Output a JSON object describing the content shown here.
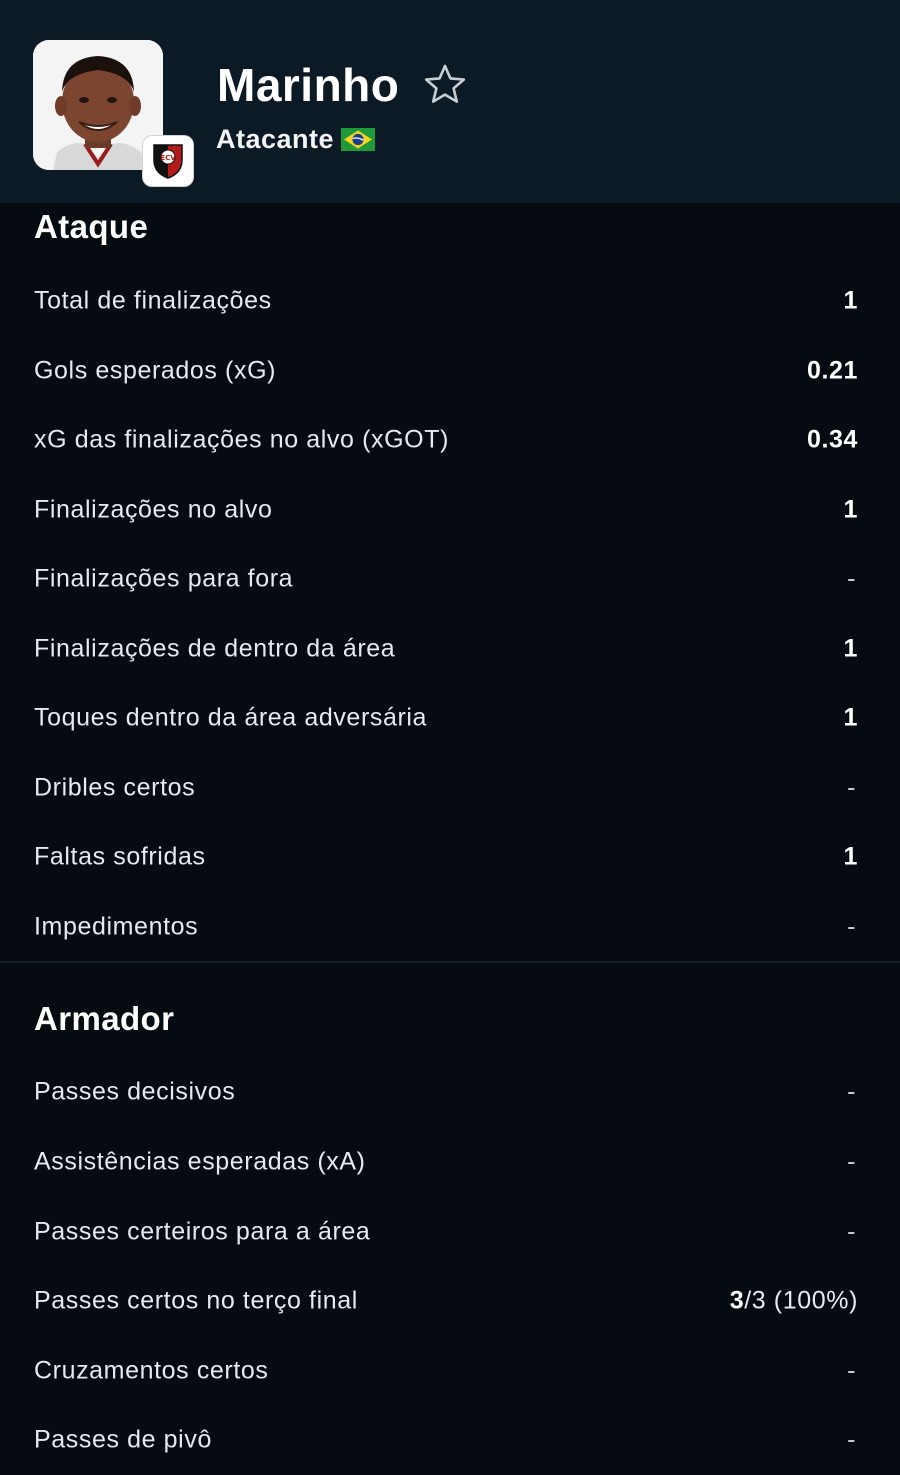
{
  "player": {
    "name": "Marinho",
    "position": "Atacante",
    "nationality_flag": "brazil-flag-icon",
    "club_badge": "club-crest-icon",
    "favorite_icon": "star-outline-icon"
  },
  "colors": {
    "background": "#050b11",
    "header_background": "#0b1a24",
    "text": "#e6eaee"
  },
  "sections": [
    {
      "title": "Ataque",
      "rows": [
        {
          "label": "Total de finalizações",
          "value": "1"
        },
        {
          "label": "Gols esperados (xG)",
          "value": "0.21"
        },
        {
          "label": "xG das finalizações no alvo (xGOT)",
          "value": "0.34"
        },
        {
          "label": "Finalizações no alvo",
          "value": "1"
        },
        {
          "label": "Finalizações para fora",
          "value": "-"
        },
        {
          "label": "Finalizações de dentro da área",
          "value": "1"
        },
        {
          "label": "Toques dentro da área adversária",
          "value": "1"
        },
        {
          "label": "Dribles certos",
          "value": "-"
        },
        {
          "label": "Faltas sofridas",
          "value": "1"
        },
        {
          "label": "Impedimentos",
          "value": "-"
        }
      ]
    },
    {
      "title": "Armador",
      "rows": [
        {
          "label": "Passes decisivos",
          "value": "-"
        },
        {
          "label": "Assistências esperadas (xA)",
          "value": "-"
        },
        {
          "label": "Passes certeiros para a área",
          "value": "-"
        },
        {
          "label": "Passes certos no terço final",
          "value_bold": "3",
          "value_rest": "/3 (100%)"
        },
        {
          "label": "Cruzamentos certos",
          "value": "-"
        },
        {
          "label": "Passes de pivô",
          "value": "-"
        }
      ]
    }
  ]
}
